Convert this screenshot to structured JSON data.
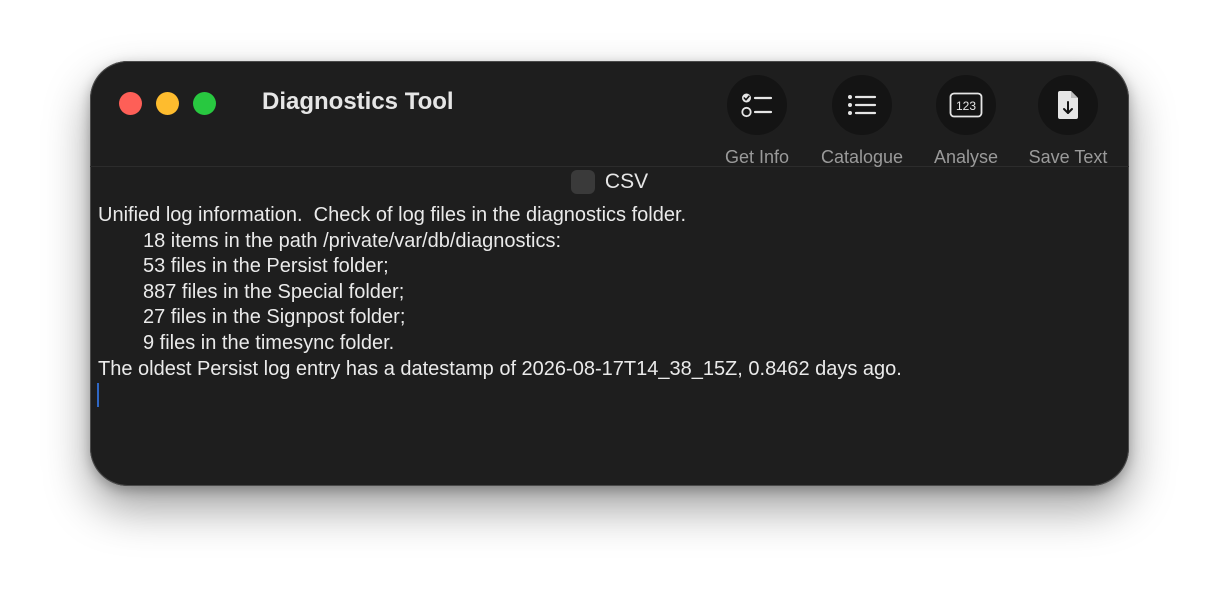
{
  "window": {
    "title": "Diagnostics Tool"
  },
  "toolbar": {
    "items": [
      {
        "label": "Get Info",
        "icon": "checklist-icon"
      },
      {
        "label": "Catalogue",
        "icon": "list-icon"
      },
      {
        "label": "Analyse",
        "icon": "numbers-icon",
        "icon_text": "123"
      },
      {
        "label": "Save Text",
        "icon": "document-download-icon"
      }
    ]
  },
  "options": {
    "csv_label": "CSV",
    "csv_checked": false
  },
  "log": {
    "lines": [
      "Unified log information.  Check of log files in the diagnostics folder.",
      "18 items in the path /private/var/db/diagnostics:",
      "53 files in the Persist folder;",
      "887 files in the Special folder;",
      "27 files in the Signpost folder;",
      "9 files in the timesync folder.",
      "The oldest Persist log entry has a datestamp of 2026-08-17T14_38_15Z, 0.8462 days ago."
    ]
  },
  "colors": {
    "close": "#fe5f57",
    "minimize": "#febc2e",
    "maximize": "#28c840",
    "background": "#1e1e1e",
    "caret": "#2f67c4"
  }
}
